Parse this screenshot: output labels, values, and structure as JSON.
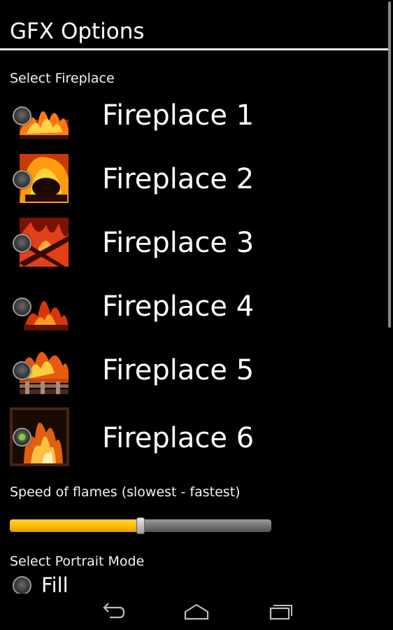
{
  "header": {
    "title": "GFX Options"
  },
  "fireplace_section": {
    "label": "Select Fireplace",
    "items": [
      {
        "name": "Fireplace 1",
        "selected": false
      },
      {
        "name": "Fireplace 2",
        "selected": false
      },
      {
        "name": "Fireplace 3",
        "selected": false
      },
      {
        "name": "Fireplace 4",
        "selected": false
      },
      {
        "name": "Fireplace 5",
        "selected": false
      },
      {
        "name": "Fireplace 6",
        "selected": true
      }
    ]
  },
  "speed_section": {
    "label": "Speed of flames (slowest - fastest)",
    "value": 0.5
  },
  "portrait_section": {
    "label": "Select Portrait Mode",
    "option": {
      "label": "Fill",
      "selected": false
    }
  },
  "navbar": {
    "icons": [
      "back-icon",
      "home-icon",
      "recent-apps-icon"
    ]
  },
  "colors": {
    "accent": "#ffc000",
    "selected_radio": "#7cd73a",
    "background": "#000000"
  }
}
